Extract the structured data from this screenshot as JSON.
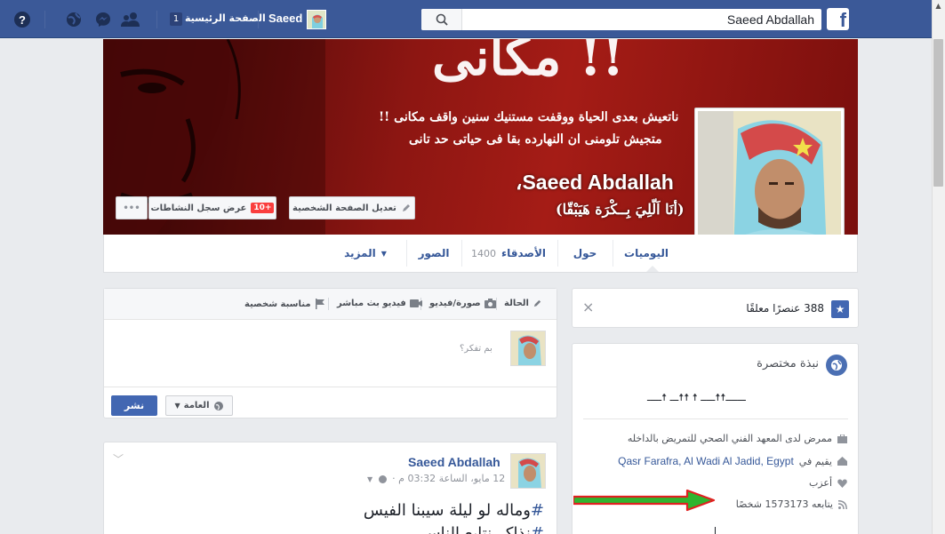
{
  "topbar": {
    "search_value": "Saeed Abdallah",
    "user_name": "Saeed",
    "home_label": "الصفحة الرئيسية",
    "home_badge": "1",
    "fb_letter": "f"
  },
  "profile": {
    "name": "Saeed Abdallah",
    "name_suffix": "،",
    "alternate_name": "(أنَا اَلّلِيَ بِــكْرَة هَيَبْقّا)",
    "cover_line_1": "ناتعيش بعدى الحياة ووقفت مستنيك سنين واقف مكانى !!",
    "cover_line_2": "متجيش تلومنى ان النهارده بقا فى حياتى حد تانى",
    "cover_big_text": "!! مكانى",
    "buttons": {
      "edit_profile": "تعديل الصفحة الشخصية",
      "activity_log": "عرض سجل النشاطات",
      "activity_badge": "10+",
      "more": "•••"
    }
  },
  "nav": {
    "timeline": "اليوميات",
    "about": "حول",
    "friends": "الأصدقاء",
    "friends_count": "1400",
    "photos": "الصور",
    "more": "المزيد"
  },
  "composer": {
    "tab_status": "الحالة",
    "tab_photo": "صورة/فيديو",
    "tab_live": "فيديو بث مباشر",
    "tab_event": "مناسبة شخصية",
    "placeholder": "بم تفكر؟",
    "privacy": "العامة",
    "post": "نشر"
  },
  "post": {
    "author": "Saeed Abdallah",
    "meta": "12 مايو، الساعة 03:32 م ·",
    "line_1_hash": "#",
    "line_1_text": "وماله لو ليلة سيبنا الفيس",
    "line_2_hash": "#",
    "line_2_text": "نذاكر نتابع الناس"
  },
  "featured": {
    "count_text": "388 عنصرًا معلقًا",
    "close": "×"
  },
  "intro": {
    "title": "نبذة مختصرة",
    "bio": "ـــــــ☨☨ـــــ ☨ ☨☨ـــ ☨ـــــ",
    "work": "ممرض لدى المعهد الفني الصحي للتمريض بالداخله",
    "lives_prefix": "يقيم في",
    "lives_place": "Qasr Farafra, Al Wadi Al Jadid, Egypt",
    "relationship": "أعزب",
    "followers": "يتابعه 1573173 شخصًا"
  },
  "colors": {
    "brand": "#3b5998",
    "link": "#365899",
    "cover_red": "#8d1612",
    "badge_red": "#fa3e3e",
    "arrow_green": "#2fb52f",
    "arrow_red": "#e02020"
  }
}
